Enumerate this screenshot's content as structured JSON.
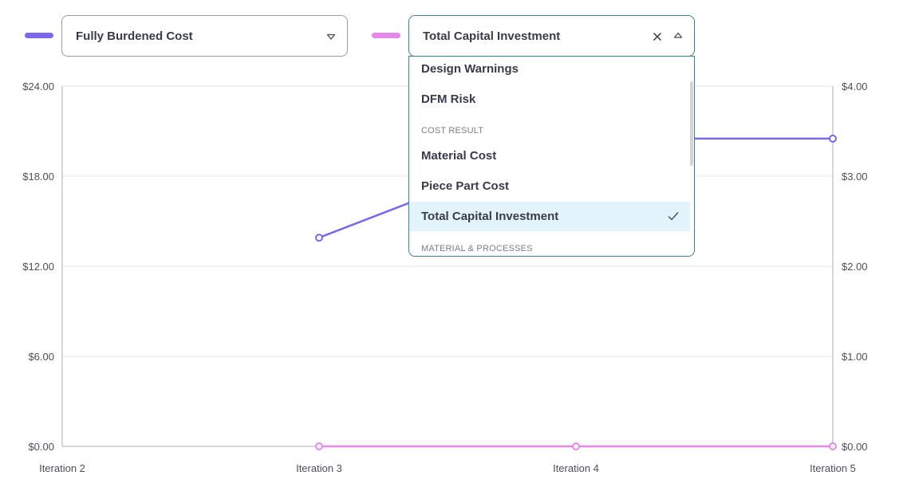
{
  "colors": {
    "series_1": "#7b68ee",
    "series_2": "#e589e8",
    "grid": "#e4e4e8",
    "axis": "#d6d6da",
    "dropdown_border": "#3f7f95",
    "selected_bg": "#e3f3fb"
  },
  "icons": {
    "select_1_toggle": "chevron-down-icon",
    "select_2_clear": "close-icon",
    "select_2_toggle": "chevron-up-icon",
    "selected_option": "check-icon"
  },
  "controls": {
    "select_1": {
      "value": "Fully Burdened Cost"
    },
    "select_2": {
      "value": "Total Capital Investment"
    }
  },
  "dropdown": {
    "items": [
      {
        "kind": "option",
        "label": "Design Warnings",
        "selected": false
      },
      {
        "kind": "option",
        "label": "DFM Risk",
        "selected": false
      },
      {
        "kind": "group",
        "label": "COST RESULT"
      },
      {
        "kind": "option",
        "label": "Material Cost",
        "selected": false
      },
      {
        "kind": "option",
        "label": "Piece Part Cost",
        "selected": false
      },
      {
        "kind": "option",
        "label": "Total Capital Investment",
        "selected": true
      },
      {
        "kind": "group",
        "label": "MATERIAL & PROCESSES"
      }
    ]
  },
  "chart_data": {
    "type": "line",
    "categories": [
      "Iteration 2",
      "Iteration 3",
      "Iteration 4",
      "Iteration 5"
    ],
    "series": [
      {
        "values": [
          null,
          13.9,
          20.5,
          20.5
        ],
        "axis": "left"
      },
      {
        "values": [
          null,
          0,
          0,
          0
        ],
        "axis": "right"
      }
    ],
    "y_left": {
      "ticks": [
        "$0.00",
        "$6.00",
        "$12.00",
        "$18.00",
        "$24.00"
      ],
      "tick_values": [
        0,
        6,
        12,
        18,
        24
      ],
      "ylim": [
        0,
        24
      ]
    },
    "y_right": {
      "ticks": [
        "$0.00",
        "$1.00",
        "$2.00",
        "$3.00",
        "$4.00"
      ],
      "tick_values": [
        0,
        1,
        2,
        3,
        4
      ],
      "ylim": [
        0,
        4
      ]
    },
    "grid": true,
    "legend": "top-left"
  }
}
